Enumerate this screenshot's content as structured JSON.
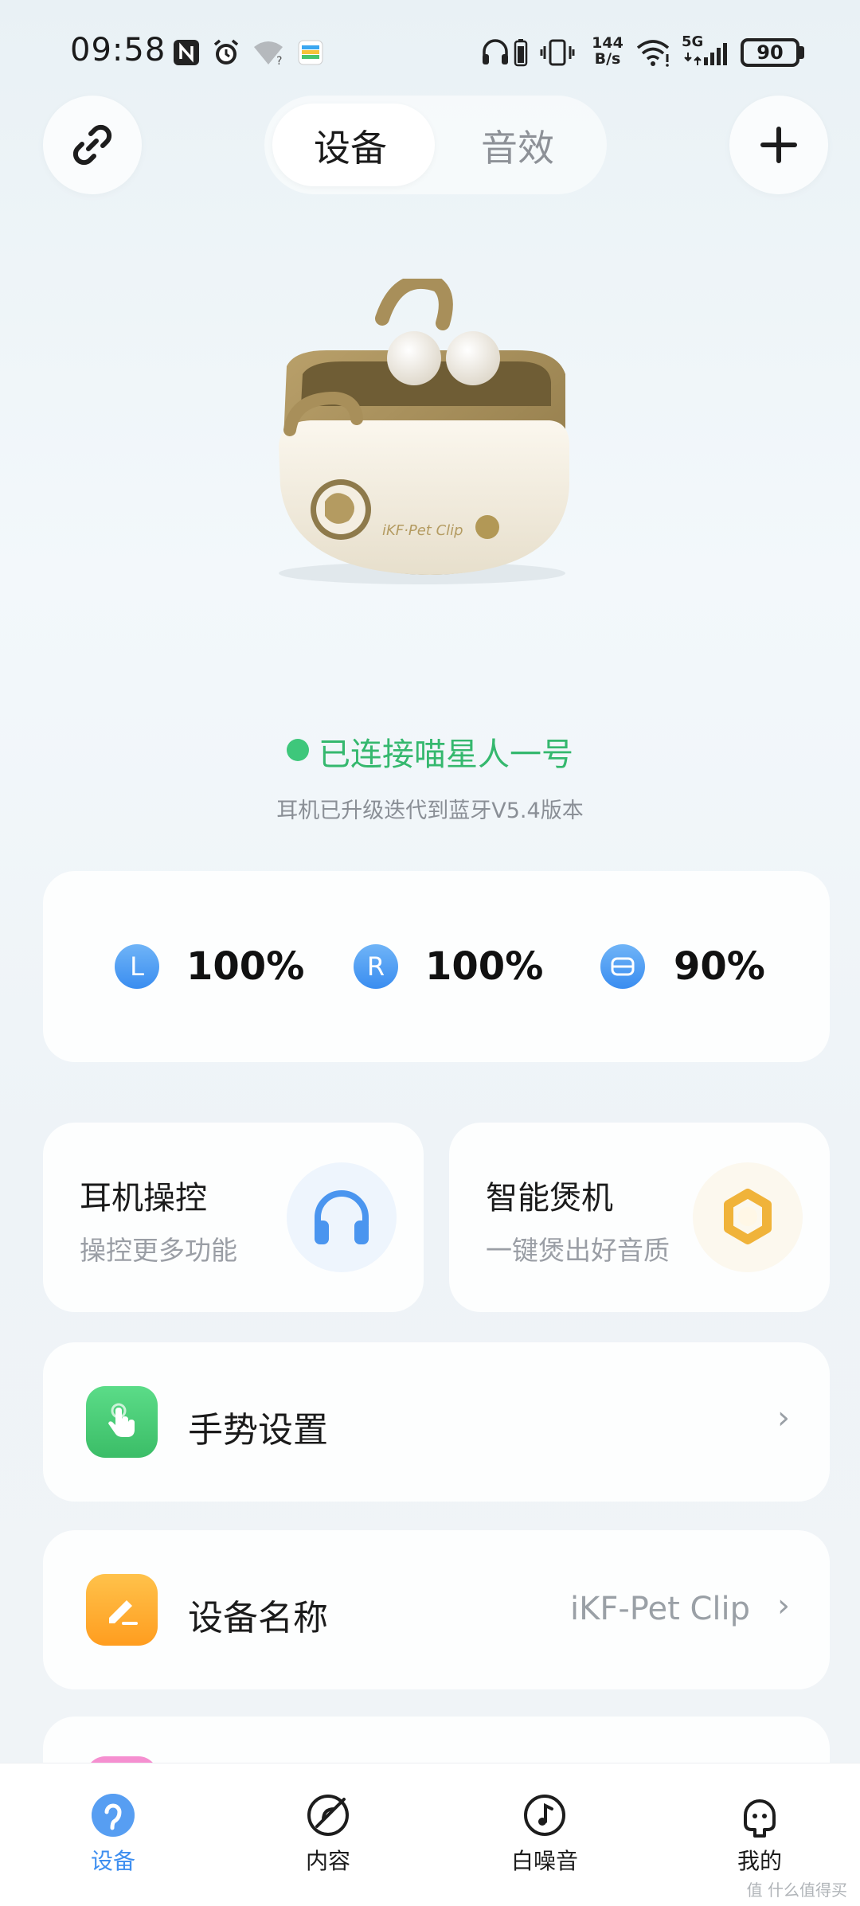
{
  "status": {
    "time": "09:58",
    "net_speed_top": "144",
    "net_speed_bottom": "B/s",
    "network": "5G",
    "battery": "90"
  },
  "header": {
    "tabs": [
      {
        "label": "设备",
        "active": true
      },
      {
        "label": "音效",
        "active": false
      }
    ],
    "left_icon": "link-icon",
    "right_icon": "plus-icon"
  },
  "device": {
    "status_text": "已连接喵星人一号",
    "status_color": "#35b86e",
    "sub_text": "耳机已升级迭代到蓝牙V5.4版本"
  },
  "battery": [
    {
      "badge": "L",
      "value": "100%"
    },
    {
      "badge": "R",
      "value": "100%"
    },
    {
      "badge": "case",
      "value": "90%"
    }
  ],
  "features": [
    {
      "title": "耳机操控",
      "subtitle": "操控更多功能",
      "icon": "headphones-icon"
    },
    {
      "title": "智能煲机",
      "subtitle": "一键煲出好音质",
      "icon": "burn-in-icon"
    }
  ],
  "rows": [
    {
      "label": "手势设置",
      "value": "",
      "icon": "gesture-icon",
      "color": "#4ccf78"
    },
    {
      "label": "设备名称",
      "value": "iKF-Pet Clip",
      "icon": "edit-icon",
      "color": "#ffb02e"
    }
  ],
  "nav": [
    {
      "label": "设备",
      "icon": "device-icon",
      "active": true
    },
    {
      "label": "内容",
      "icon": "content-icon",
      "active": false
    },
    {
      "label": "白噪音",
      "icon": "white-noise-icon",
      "active": false
    },
    {
      "label": "我的",
      "icon": "profile-icon",
      "active": false
    }
  ],
  "accent_color": "#3d8ef0",
  "watermark": "值 什么值得买"
}
